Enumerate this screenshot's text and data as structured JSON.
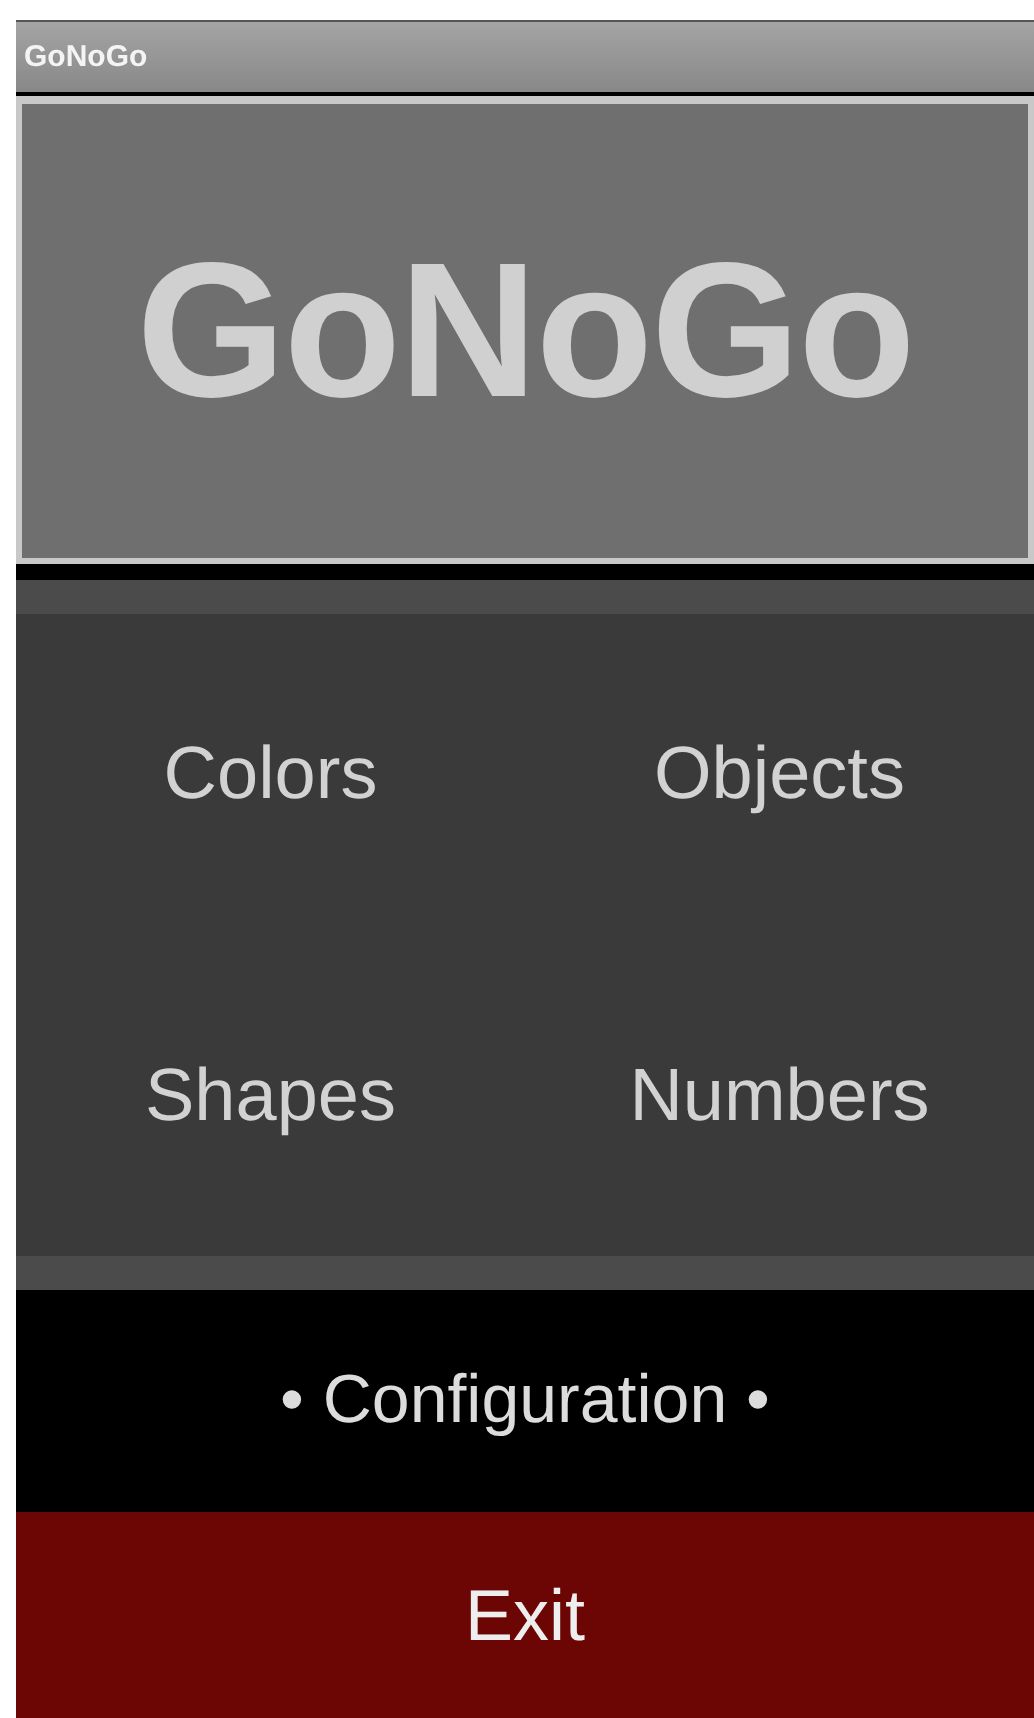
{
  "window": {
    "title": "GoNoGo"
  },
  "logo": {
    "text": "GoNoGo"
  },
  "menu": [
    {
      "label": "Colors"
    },
    {
      "label": "Objects"
    },
    {
      "label": "Shapes"
    },
    {
      "label": "Numbers"
    }
  ],
  "configuration": {
    "label": "• Configuration •"
  },
  "exit": {
    "label": "Exit"
  }
}
